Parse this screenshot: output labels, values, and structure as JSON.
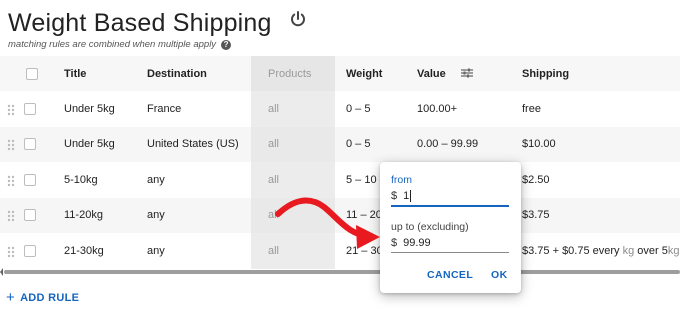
{
  "header": {
    "title": "Weight Based Shipping",
    "subtitle": "matching rules are combined when multiple apply",
    "help_glyph": "?"
  },
  "table": {
    "columns": {
      "title": "Title",
      "destination": "Destination",
      "products": "Products",
      "weight": "Weight",
      "value": "Value",
      "shipping": "Shipping"
    },
    "rows": [
      {
        "title": "Under 5kg",
        "destination": "France",
        "products": "all",
        "weight": "0 – 5",
        "value": "100.00+",
        "shipping": "free"
      },
      {
        "title": "Under 5kg",
        "destination": "United States (US)",
        "products": "all",
        "weight": "0 – 5",
        "value": "0.00 – 99.99",
        "shipping": "$10.00"
      },
      {
        "title": "5-10kg",
        "destination": "any",
        "products": "all",
        "weight": "5 – 10",
        "value": "",
        "shipping": "$2.50"
      },
      {
        "title": "11-20kg",
        "destination": "any",
        "products": "all",
        "weight": "11 – 20",
        "value": "",
        "shipping": "$3.75"
      },
      {
        "title": "21-30kg",
        "destination": "any",
        "products": "all",
        "weight": "21 – 30",
        "value": "",
        "shipping_parts": {
          "base": "$3.75 + $0.75 every",
          "unit1": "kg",
          "mid": "over 5",
          "unit2": "kg"
        }
      }
    ]
  },
  "add_rule": {
    "plus": "+",
    "label": "ADD RULE"
  },
  "value_popup": {
    "from_label": "from",
    "from_currency": "$",
    "from_value": "1",
    "upto_label": "up to (excluding)",
    "upto_currency": "$",
    "upto_value": "99.99",
    "cancel_label": "CANCEL",
    "ok_label": "OK"
  },
  "colors": {
    "accent": "#1565c0",
    "annotation_arrow": "#e8191f",
    "header_bg": "#f7f7f7",
    "products_col_bg": "#ececec"
  },
  "icons": {
    "power": "power-icon",
    "help": "help-icon",
    "drag": "drag-handle-icon",
    "filter": "filter-sliders-icon",
    "annotation": "red-curved-arrow-icon"
  }
}
